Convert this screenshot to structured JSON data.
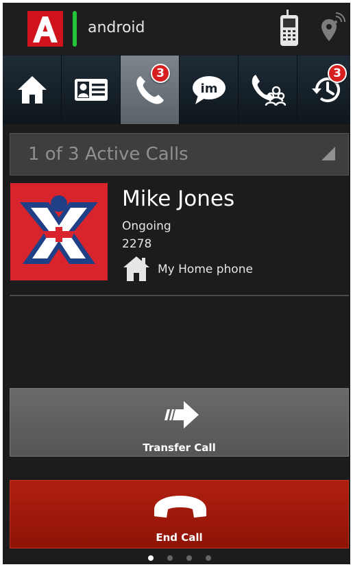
{
  "status_bar": {
    "app_name": "android",
    "icons": [
      "app-logo-icon",
      "mobile-phone-icon",
      "location-signal-icon"
    ],
    "presence_color": "#22c43a"
  },
  "toolbar": {
    "items": [
      {
        "name": "home",
        "icon": "home-icon"
      },
      {
        "name": "contacts",
        "icon": "contact-card-icon"
      },
      {
        "name": "calls",
        "icon": "phone-icon",
        "badge": "3",
        "active": true
      },
      {
        "name": "im",
        "icon": "im-chat-icon"
      },
      {
        "name": "conference",
        "icon": "conference-call-icon"
      },
      {
        "name": "history",
        "icon": "call-history-icon",
        "badge": "3"
      }
    ]
  },
  "active_calls": {
    "label": "1 of 3 Active Calls"
  },
  "caller": {
    "name": "Mike Jones",
    "status": "Ongoing",
    "number": "2278",
    "phone_type": "My Home phone",
    "phone_type_icon": "home-icon"
  },
  "actions": {
    "transfer_label": "Transfer Call",
    "end_call_label": "End Call",
    "end_call_color": "#a5180b"
  },
  "pager": {
    "pages": 4,
    "current": 1
  }
}
